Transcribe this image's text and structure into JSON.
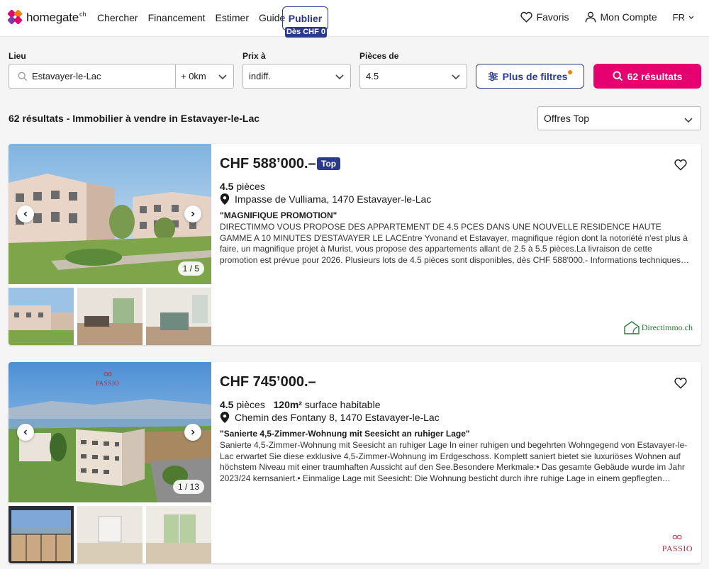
{
  "header": {
    "logo_text": "homegate",
    "logo_sup": "ch",
    "nav": [
      "Chercher",
      "Financement",
      "Estimer",
      "Guide"
    ],
    "publish_label": "Publier",
    "publish_badge": "Dès CHF 0",
    "favorites": "Favoris",
    "account": "Mon Compte",
    "language": "FR"
  },
  "filters": {
    "location_label": "Lieu",
    "location_value": "Estavayer-le-Lac",
    "radius": "+ 0km",
    "price_label": "Prix à",
    "price_value": "indiff.",
    "rooms_label": "Pièces de",
    "rooms_value": "4.5",
    "more_filters": "Plus de filtres",
    "results_button": "62 résultats"
  },
  "results": {
    "title": "62 résultats - Immobilier à vendre in Estavayer-le-Lac",
    "sort_value": "Offres Top"
  },
  "listings": [
    {
      "price": "CHF 588’000.–",
      "badge": "Top",
      "rooms": "4.5",
      "rooms_suffix": "pièces",
      "surface": "",
      "surface_suffix": "",
      "address": "Impasse de Vulliama, 1470 Estavayer-le-Lac",
      "headline": "\"MAGNIFIQUE PROMOTION\"",
      "description": "DIRECTIMMO VOUS PROPOSE DES APPARTEMENT DE 4.5 PCES DANS UNE NOUVELLE RESIDENCE HAUTE GAMME A 10 MINUTES D'ESTAVAYER LE LACEntre Yvonand et Estavayer, magnifique région dont la notoriété n'est plus à faire, un magnifique projet à Murist, vous propose des appartements allant de 2.5 à 5.5 pièces.La livraison de cette promotion est prévue pour 2026. Plusieurs lots de 4.5 pièces sont disponibles, dès CHF 588'000.- Informations techniques : • Triple vitrage • Interphone • Thermostats...",
      "counter": "1 / 5",
      "agency": "Directimmo.ch"
    },
    {
      "price": "CHF 745’000.–",
      "badge": "",
      "rooms": "4.5",
      "rooms_suffix": "pièces",
      "surface": "120m²",
      "surface_suffix": "surface habitable",
      "address": "Chemin des Fontany 8, 1470 Estavayer-le-Lac",
      "headline": "\"Sanierte 4,5-Zimmer-Wohnung mit Seesicht an ruhiger Lage\"",
      "description": "Sanierte 4,5-Zimmer-Wohnung mit Seesicht an ruhiger Lage In einer ruhigen und begehrten Wohngegend von Estavayer-le-Lac erwartet Sie diese exklusive 4,5-Zimmer-Wohnung im Erdgeschoss. Komplett saniert bietet sie luxuriöses Wohnen auf höchstem Niveau mit einer traumhaften Aussicht auf den See.Besondere Merkmale:• Das gesamte Gebäude wurde im Jahr 2023/24 kernsaniert.• Einmalige Lage mit Seesicht: Die Wohnung besticht durch ihre ruhige Lage in einem gepflegten Quartier sowie einer...",
      "counter": "1 / 13",
      "agency": "PASSIO",
      "image_logo": "PASSIO"
    }
  ],
  "colors": {
    "brand_blue": "#2a3a8f",
    "brand_pink": "#e6006f",
    "notify_orange": "#ff7a00"
  }
}
